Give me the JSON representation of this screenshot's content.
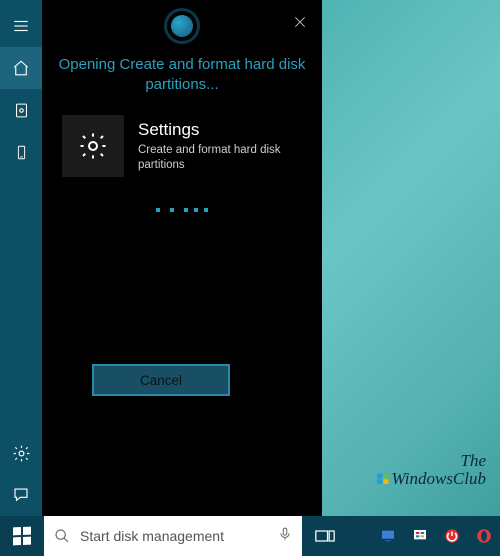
{
  "sidebar": {
    "items": [
      {
        "name": "menu"
      },
      {
        "name": "home"
      },
      {
        "name": "notebook"
      },
      {
        "name": "devices"
      },
      {
        "name": "settings"
      },
      {
        "name": "feedback"
      }
    ]
  },
  "cortana": {
    "opening_text": "Opening Create and format hard disk partitions...",
    "result": {
      "title": "Settings",
      "subtitle": "Create and format hard disk partitions"
    },
    "cancel_label": "Cancel"
  },
  "watermark": {
    "line1": "The",
    "line2": "WindowsClub"
  },
  "taskbar": {
    "search_value": "Start disk management"
  },
  "colors": {
    "accent": "#2aa0be",
    "sidebar": "#0d4f64",
    "taskbar": "#0a3f53"
  }
}
